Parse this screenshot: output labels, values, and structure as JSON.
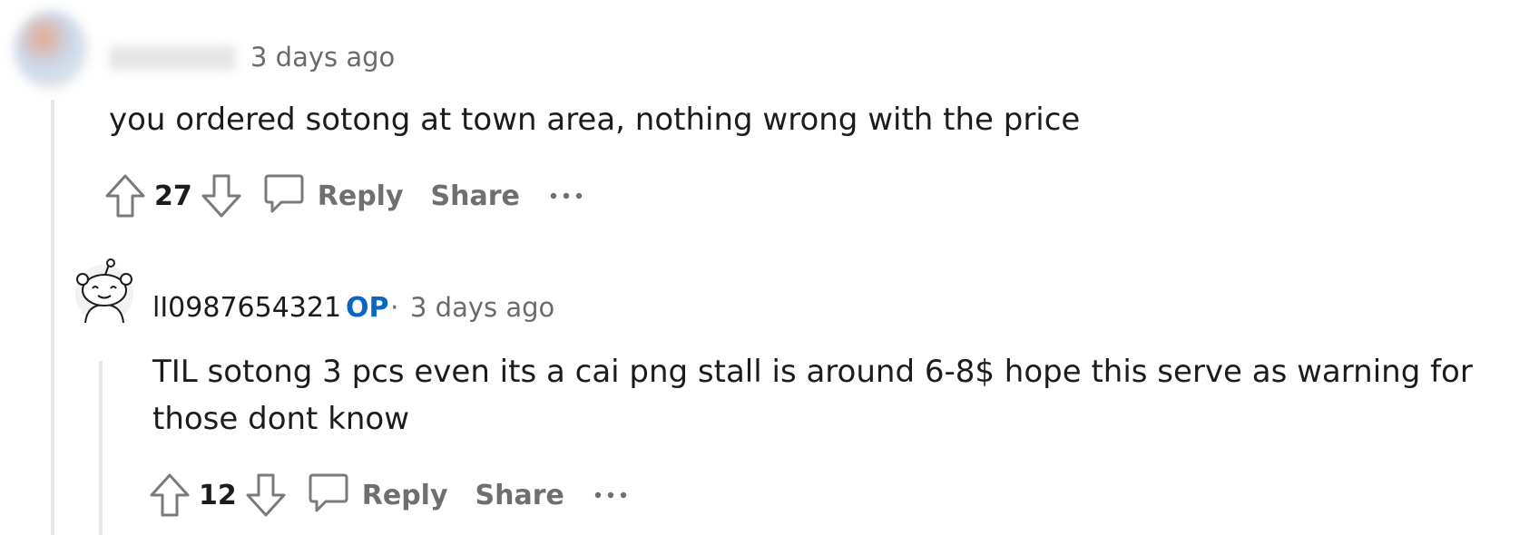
{
  "comment_1": {
    "time": "3 days ago",
    "body": "you ordered sotong at town area, nothing wrong with the price",
    "score": "27",
    "actions": {
      "reply": "Reply",
      "share": "Share"
    }
  },
  "comment_2": {
    "username": "lI0987654321",
    "badge": "OP",
    "separator": "·",
    "time": "3 days ago",
    "body": "TIL sotong 3 pcs even its a cai png stall is around 6-8$ hope this serve as warning for those dont know",
    "score": "12",
    "actions": {
      "reply": "Reply",
      "share": "Share"
    }
  },
  "icons": {
    "upvote": "upvote-arrow-icon",
    "downvote": "downvote-arrow-icon",
    "reply": "comment-bubble-icon",
    "more": "more-horizontal-icon"
  },
  "colors": {
    "op_badge": "#0a66c2",
    "muted_text": "#6f6f6f",
    "thread_line": "#e8e8e8"
  }
}
